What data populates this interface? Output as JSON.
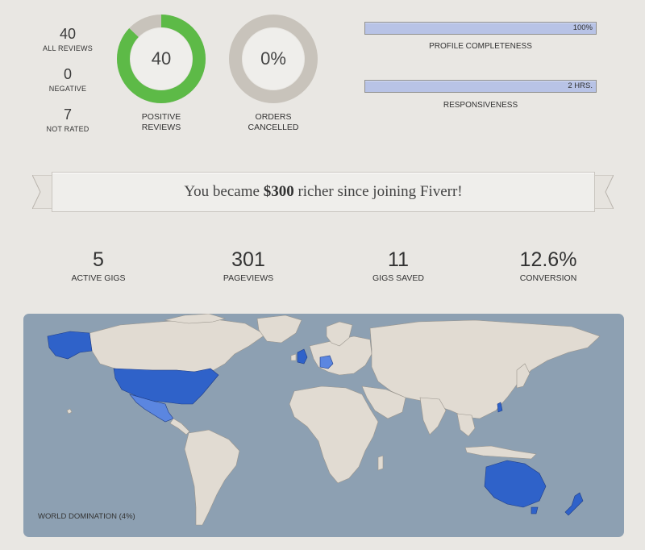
{
  "left_stats": [
    {
      "value": "40",
      "label": "All reviews"
    },
    {
      "value": "0",
      "label": "Negative"
    },
    {
      "value": "7",
      "label": "Not rated"
    }
  ],
  "rings": [
    {
      "center": "40",
      "label_line1": "Positive",
      "label_line2": "Reviews",
      "fill_fraction": 0.87,
      "color": "#5dba47",
      "track": "#c8c3bb"
    },
    {
      "center": "0%",
      "label_line1": "Orders",
      "label_line2": "Cancelled",
      "fill_fraction": 0.0,
      "color": "#5dba47",
      "track": "#c8c3bb"
    }
  ],
  "bars": [
    {
      "value": "100%",
      "label": "Profile completeness",
      "fill_fraction": 1.0
    },
    {
      "value": "2 HRS.",
      "label": "Responsiveness",
      "fill_fraction": 1.0
    }
  ],
  "banner": {
    "prefix": "You became ",
    "amount": "$300",
    "suffix": " richer since joining Fiverr!"
  },
  "big_stats": [
    {
      "value": "5",
      "label": "Active gigs"
    },
    {
      "value": "301",
      "label": "Pageviews"
    },
    {
      "value": "11",
      "label": "Gigs saved"
    },
    {
      "value": "12.6%",
      "label": "Conversion"
    }
  ],
  "map": {
    "caption": "World domination (4%)",
    "ocean_color": "#8da0b2",
    "land_color": "#e1dbd2",
    "highlight_color": "#2f62c9",
    "highlighted_regions": [
      "United States",
      "Alaska",
      "Mexico",
      "United Kingdom",
      "Germany",
      "Australia",
      "New Zealand",
      "Taiwan"
    ]
  }
}
